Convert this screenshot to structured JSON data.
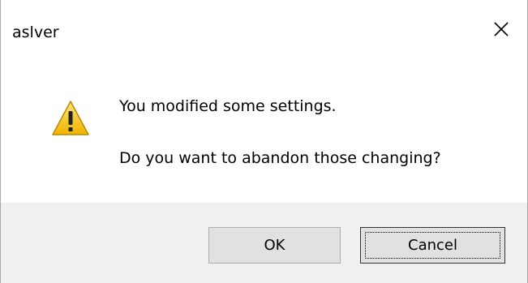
{
  "window": {
    "title": "aslver",
    "close_icon": "close-icon"
  },
  "message": {
    "icon": "warning-icon",
    "line1": "You modified some settings.",
    "line2": "Do you want to abandon those changing?"
  },
  "buttons": {
    "ok_label": "OK",
    "cancel_label": "Cancel"
  },
  "colors": {
    "footer_bg": "#f0f0f0",
    "button_bg": "#e1e1e1",
    "warning_yellow": "#f5c400"
  }
}
